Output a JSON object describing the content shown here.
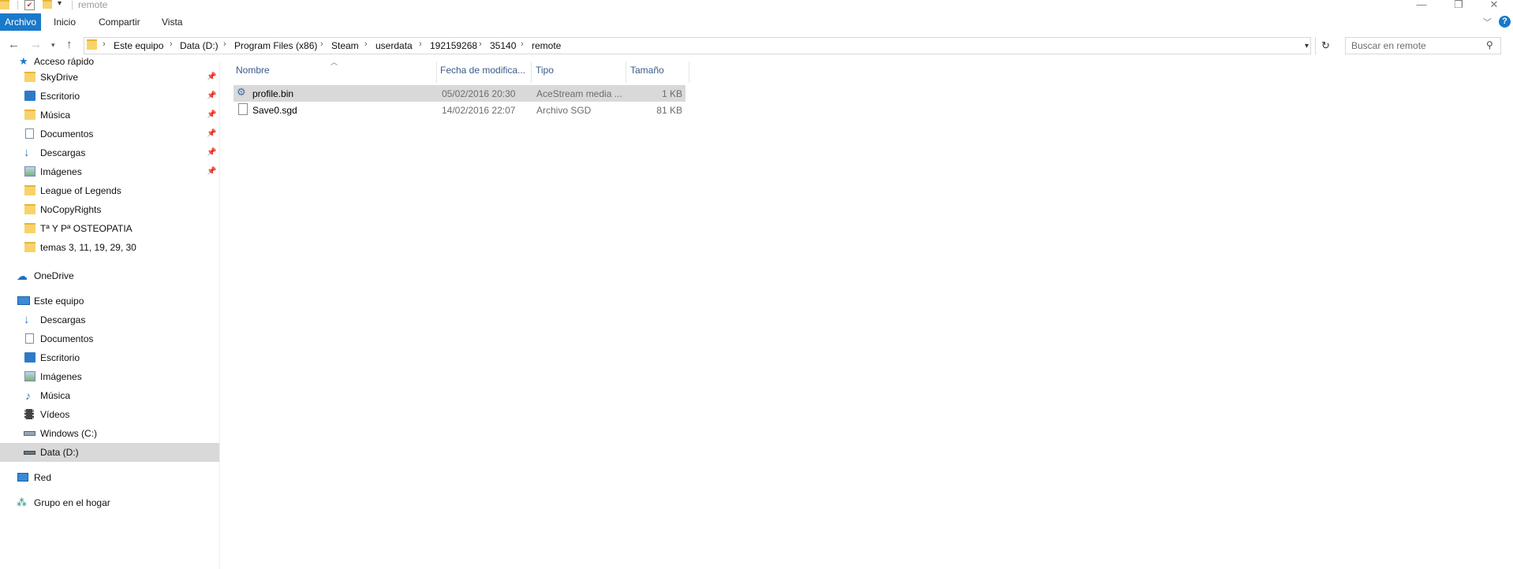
{
  "window": {
    "title": "remote",
    "controls": {
      "minimize": "—",
      "restore": "❐",
      "close": "✕"
    }
  },
  "ribbon": {
    "tabs": [
      {
        "label": "Archivo",
        "active": true
      },
      {
        "label": "Inicio",
        "active": false
      },
      {
        "label": "Compartir",
        "active": false
      },
      {
        "label": "Vista",
        "active": false
      }
    ],
    "expand_icon": "chevron-down-icon",
    "help_icon": "?"
  },
  "address": {
    "breadcrumbs": [
      "Este equipo",
      "Data (D:)",
      "Program Files (x86)",
      "Steam",
      "userdata",
      "192159268",
      "35140",
      "remote"
    ],
    "separator": "›"
  },
  "search": {
    "placeholder": "Buscar en remote"
  },
  "sidebar": {
    "quick_access": {
      "label": "Acceso rápido",
      "items": [
        {
          "label": "SkyDrive",
          "icon": "folder-icon",
          "pinned": true
        },
        {
          "label": "Escritorio",
          "icon": "desktop-icon",
          "pinned": true
        },
        {
          "label": "Música",
          "icon": "folder-icon",
          "pinned": true
        },
        {
          "label": "Documentos",
          "icon": "documents-icon",
          "pinned": true
        },
        {
          "label": "Descargas",
          "icon": "download-icon",
          "pinned": true
        },
        {
          "label": "Imágenes",
          "icon": "pictures-icon",
          "pinned": true
        },
        {
          "label": "League of Legends",
          "icon": "folder-icon",
          "pinned": false
        },
        {
          "label": "NoCopyRights",
          "icon": "folder-icon",
          "pinned": false
        },
        {
          "label": "Tª Y Pª OSTEOPATIA",
          "icon": "folder-icon",
          "pinned": false
        },
        {
          "label": "temas 3, 11, 19, 29, 30",
          "icon": "folder-icon",
          "pinned": false
        }
      ]
    },
    "onedrive": {
      "label": "OneDrive"
    },
    "this_pc": {
      "label": "Este equipo",
      "items": [
        {
          "label": "Descargas",
          "icon": "download-icon"
        },
        {
          "label": "Documentos",
          "icon": "documents-icon"
        },
        {
          "label": "Escritorio",
          "icon": "desktop-icon"
        },
        {
          "label": "Imágenes",
          "icon": "pictures-icon"
        },
        {
          "label": "Música",
          "icon": "music-icon"
        },
        {
          "label": "Vídeos",
          "icon": "videos-icon"
        },
        {
          "label": "Windows (C:)",
          "icon": "drive-c-icon"
        },
        {
          "label": "Data (D:)",
          "icon": "drive-icon",
          "selected": true
        }
      ]
    },
    "network": {
      "label": "Red"
    },
    "homegroup": {
      "label": "Grupo en el hogar"
    }
  },
  "files": {
    "columns": [
      "Nombre",
      "Fecha de modifica...",
      "Tipo",
      "Tamaño"
    ],
    "rows": [
      {
        "name": "profile.bin",
        "date": "05/02/2016 20:30",
        "type": "AceStream media ...",
        "size": "1 KB",
        "selected": true
      },
      {
        "name": "Save0.sgd",
        "date": "14/02/2016 22:07",
        "type": "Archivo SGD",
        "size": "81 KB",
        "selected": false
      }
    ]
  },
  "colors": {
    "accent": "#1979ca",
    "selection": "#d9d9d9",
    "folder": "#f8d36b",
    "header_text": "#3a5a8c"
  }
}
